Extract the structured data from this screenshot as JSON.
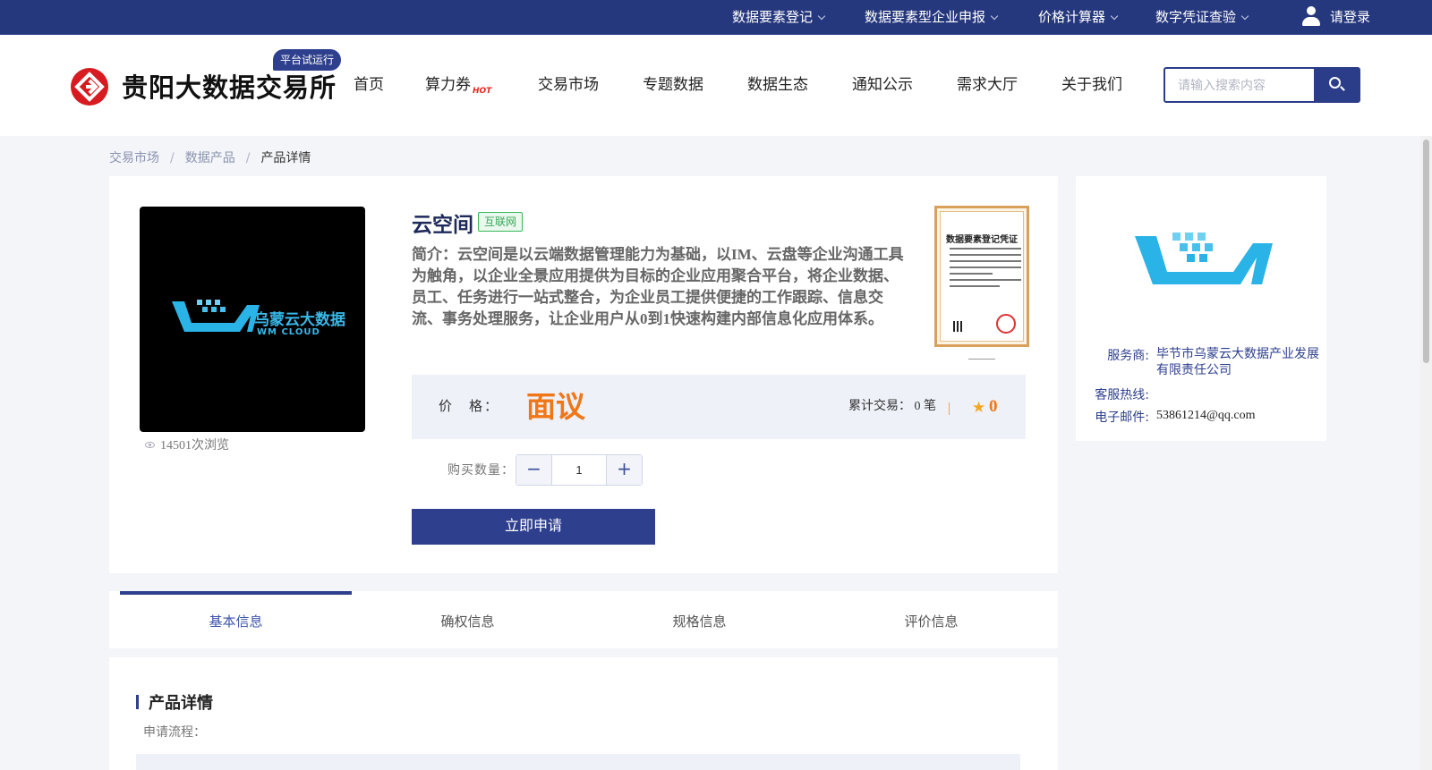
{
  "topbar": {
    "links": [
      "数据要素登记",
      "数据要素型企业申报",
      "价格计算器",
      "数字凭证查验"
    ],
    "login": "请登录"
  },
  "header": {
    "brand": "贵阳大数据交易所",
    "trial_badge": "平台试运行",
    "nav": [
      "首页",
      "算力券",
      "交易市场",
      "专题数据",
      "数据生态",
      "通知公示",
      "需求大厅",
      "关于我们"
    ],
    "hot_badge": "HOT",
    "search_placeholder": "请输入搜索内容"
  },
  "breadcrumb": [
    "交易市场",
    "数据产品",
    "产品详情"
  ],
  "product": {
    "logo_text": "乌蒙云大数据",
    "logo_subtext": "WM CLOUD",
    "views": "14501次浏览",
    "title": "云空间",
    "tag": "互联网",
    "description": "简介：云空间是以云端数据管理能力为基础，以IM、云盘等企业沟通工具为触角，以企业全景应用提供为目标的企业应用聚合平台，将企业数据、员工、任务进行一站式整合，为企业员工提供便捷的工作跟踪、信息交流、事务处理服务，让企业用户从0到1快速构建内部信息化应用体系。",
    "certificate_title": "数据要素登记凭证",
    "price_label": "价　格：",
    "price_value": "面议",
    "trades": "累计交易：  0 笔",
    "rating": "0",
    "quantity_label": "购买数量：",
    "quantity": "1",
    "apply_button": "立即申请"
  },
  "seller": {
    "provider_label": "服务商:",
    "provider": "毕节市乌蒙云大数据产业发展有限责任公司",
    "hotline_label": "客服热线:",
    "hotline": "",
    "email_label": "电子邮件:",
    "email": "53861214@qq.com"
  },
  "tabs": [
    "基本信息",
    "确权信息",
    "规格信息",
    "评价信息"
  ],
  "details": {
    "title": "产品详情",
    "flow_label": "申请流程："
  },
  "colors": {
    "primary": "#2d3f8d",
    "topbar": "#26387d",
    "price": "#f07718",
    "logo_red": "#d71b20"
  }
}
